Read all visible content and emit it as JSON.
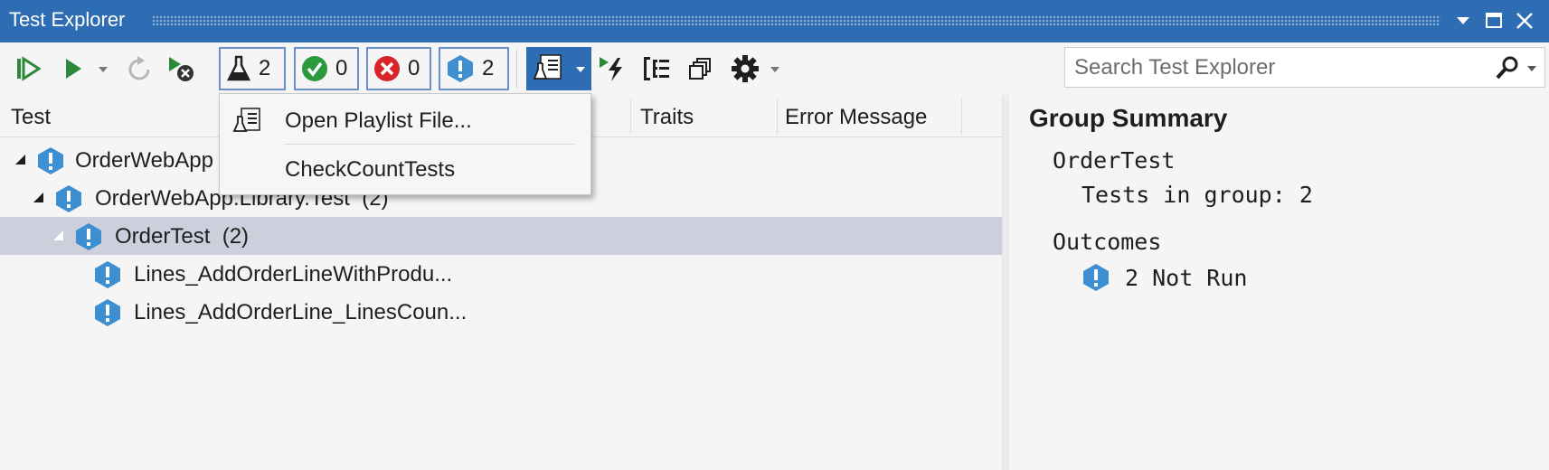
{
  "window": {
    "title": "Test Explorer"
  },
  "toolbar": {
    "filters": [
      {
        "icon": "flask-icon",
        "count": "2"
      },
      {
        "icon": "passed-icon",
        "count": "0"
      },
      {
        "icon": "failed-icon",
        "count": "0"
      },
      {
        "icon": "not-run-icon",
        "count": "2"
      }
    ],
    "search_placeholder": "Search Test Explorer"
  },
  "columns": [
    "Test",
    "Traits",
    "Error Message"
  ],
  "tree": [
    {
      "label": "OrderWebApp",
      "suffix": ""
    },
    {
      "label": "OrderWebApp.Library.Test",
      "suffix": "(2)"
    },
    {
      "label": "OrderTest",
      "suffix": "(2)"
    },
    {
      "label": "Lines_AddOrderLineWithProdu...",
      "suffix": ""
    },
    {
      "label": "Lines_AddOrderLine_LinesCoun...",
      "suffix": ""
    }
  ],
  "playlist_menu": {
    "items": [
      {
        "label": "Open Playlist File..."
      },
      {
        "label": "CheckCountTests"
      }
    ]
  },
  "summary": {
    "title": "Group Summary",
    "group_name": "OrderTest",
    "tests_in_group": "Tests in group: 2",
    "outcomes_label": "Outcomes",
    "outcome": "2 Not Run"
  },
  "colors": {
    "accent": "#2e6db3",
    "info": "#3d8fd1",
    "passed": "#2a9a3c",
    "failed": "#d9252a",
    "selected_row": "#ccd0dd"
  }
}
